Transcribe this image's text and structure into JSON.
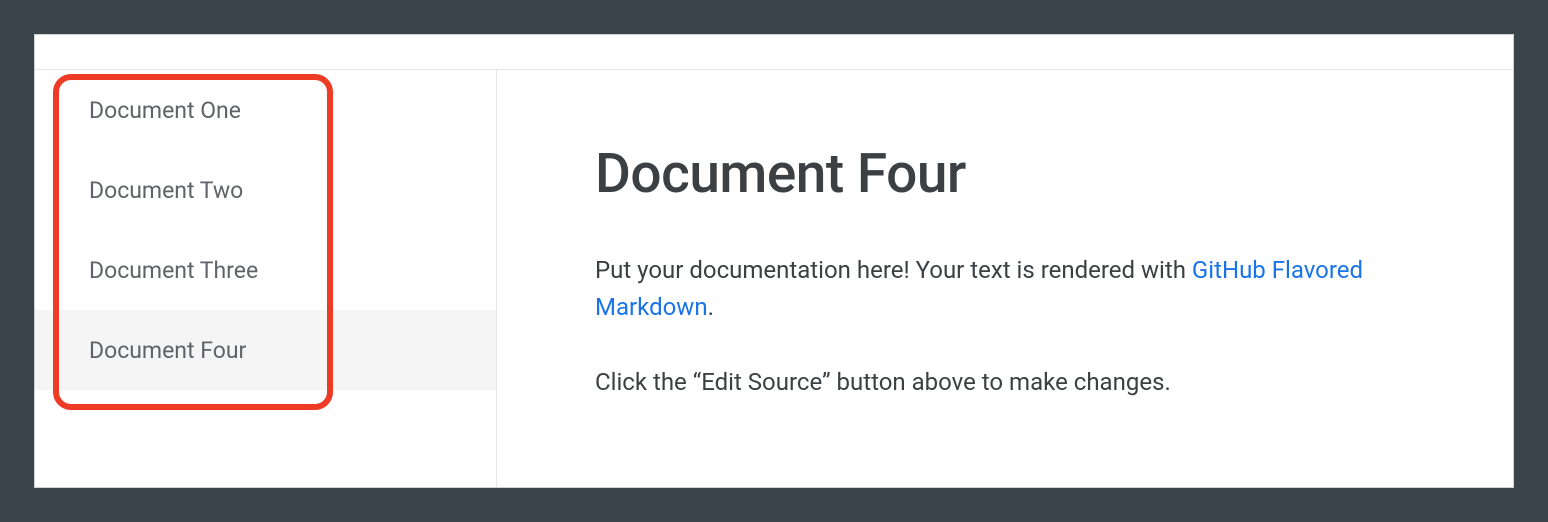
{
  "sidebar": {
    "items": [
      {
        "label": "Document One",
        "selected": false
      },
      {
        "label": "Document Two",
        "selected": false
      },
      {
        "label": "Document Three",
        "selected": false
      },
      {
        "label": "Document Four",
        "selected": true
      }
    ]
  },
  "main": {
    "title": "Document Four",
    "paragraph1_prefix": "Put your documentation here! Your text is rendered with ",
    "link_text": "GitHub Flavored Markdown",
    "paragraph1_suffix": ".",
    "paragraph2": "Click the “Edit Source” button above to make changes."
  }
}
